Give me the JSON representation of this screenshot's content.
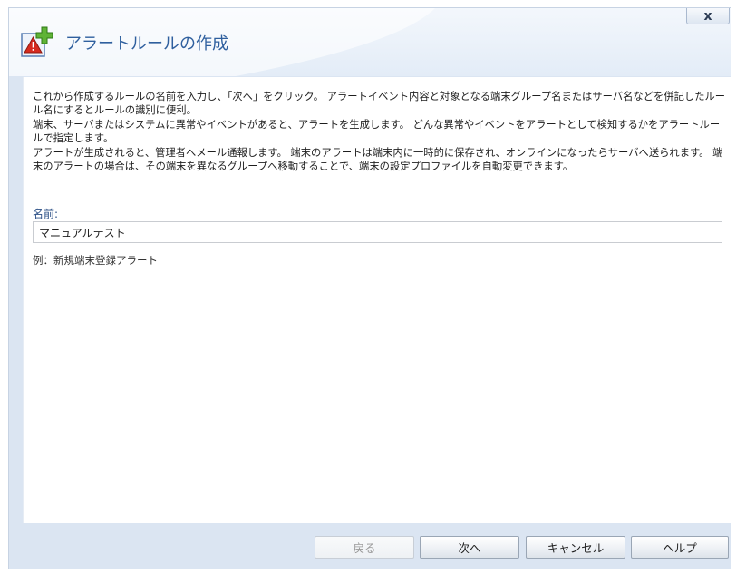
{
  "dialog": {
    "title": "アラートルールの作成",
    "close_label": "x"
  },
  "description": [
    "これから作成するルールの名前を入力し、「次へ」をクリック。 アラートイベント内容と対象となる端末グループ名またはサーバ名などを併記したルール名にするとルールの識別に便利。",
    "端末、サーバまたはシステムに異常やイベントがあると、アラートを生成します。 どんな異常やイベントをアラートとして検知するかをアラートルールで指定します。",
    "アラートが生成されると、管理者へメール通報します。 端末のアラートは端末内に一時的に保存され、オンラインになったらサーバへ送られます。 端末のアラートの場合は、その端末を異なるグループへ移動することで、端末の設定プロファイルを自動変更できます。"
  ],
  "name_field": {
    "label": "名前:",
    "value": "マニュアルテスト",
    "example": "例：新規端末登録アラート"
  },
  "buttons": {
    "back": "戻る",
    "next": "次へ",
    "cancel": "キャンセル",
    "help": "ヘルプ"
  }
}
